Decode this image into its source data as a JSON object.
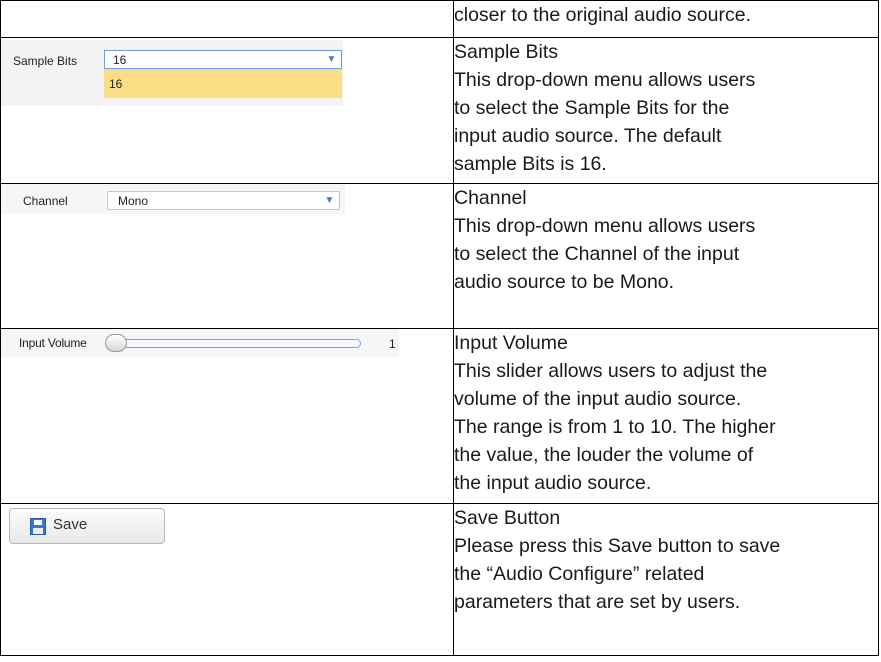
{
  "rows": [
    {
      "right_lines": [
        "closer to the original audio source."
      ]
    },
    {
      "widget": {
        "label": "Sample Bits",
        "selected": "16",
        "highlighted_option": "16"
      },
      "right_lines": [
        "Sample Bits",
        "This drop-down menu allows users",
        "to select the Sample Bits for the",
        "input audio source. The default",
        "sample Bits is 16."
      ]
    },
    {
      "widget": {
        "label": "Channel",
        "selected": "Mono"
      },
      "right_lines": [
        "Channel",
        "This drop-down menu allows users",
        "to select the Channel of the input",
        "audio source to be Mono."
      ]
    },
    {
      "widget": {
        "label": "Input Volume",
        "value": "1",
        "min": 1,
        "max": 10,
        "fraction": 0
      },
      "right_lines": [
        "Input Volume",
        "This slider allows users to adjust the",
        "volume of the input audio source.",
        "The range is from 1 to 10. The higher",
        "the value, the louder the volume of",
        "the input audio source."
      ]
    },
    {
      "widget": {
        "label": "Save",
        "icon": "floppy-disk-icon"
      },
      "right_lines": [
        "Save Button",
        "Please press this Save button to save",
        "the “Audio Configure” related",
        "parameters that are set by users."
      ]
    }
  ],
  "colors": {
    "highlight": "#fbdd86",
    "select_arrow": "#4a78c2",
    "save_icon": "#3977c9"
  }
}
